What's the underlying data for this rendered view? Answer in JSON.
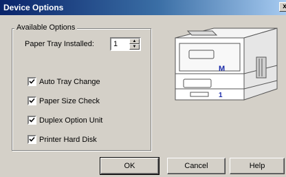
{
  "window": {
    "title": "Device Options",
    "close_glyph": "x"
  },
  "available_options": {
    "legend": "Available Options",
    "paper_tray_label": "Paper Tray Installed:",
    "paper_tray_value": "1",
    "checkboxes": [
      {
        "label": "Auto Tray Change",
        "checked": true
      },
      {
        "label": "Paper Size Check",
        "checked": true
      },
      {
        "label": "Duplex Option Unit",
        "checked": true
      },
      {
        "label": "Printer Hard Disk",
        "checked": true
      }
    ]
  },
  "printer_image": {
    "brand_mark": "M",
    "tray_number": "1"
  },
  "buttons": {
    "ok": "OK",
    "cancel": "Cancel",
    "help": "Help"
  },
  "colors": {
    "title_start": "#0a246a",
    "title_end": "#a6caf0",
    "face": "#d4d0c8",
    "printer_mark": "#1a2aa8"
  }
}
